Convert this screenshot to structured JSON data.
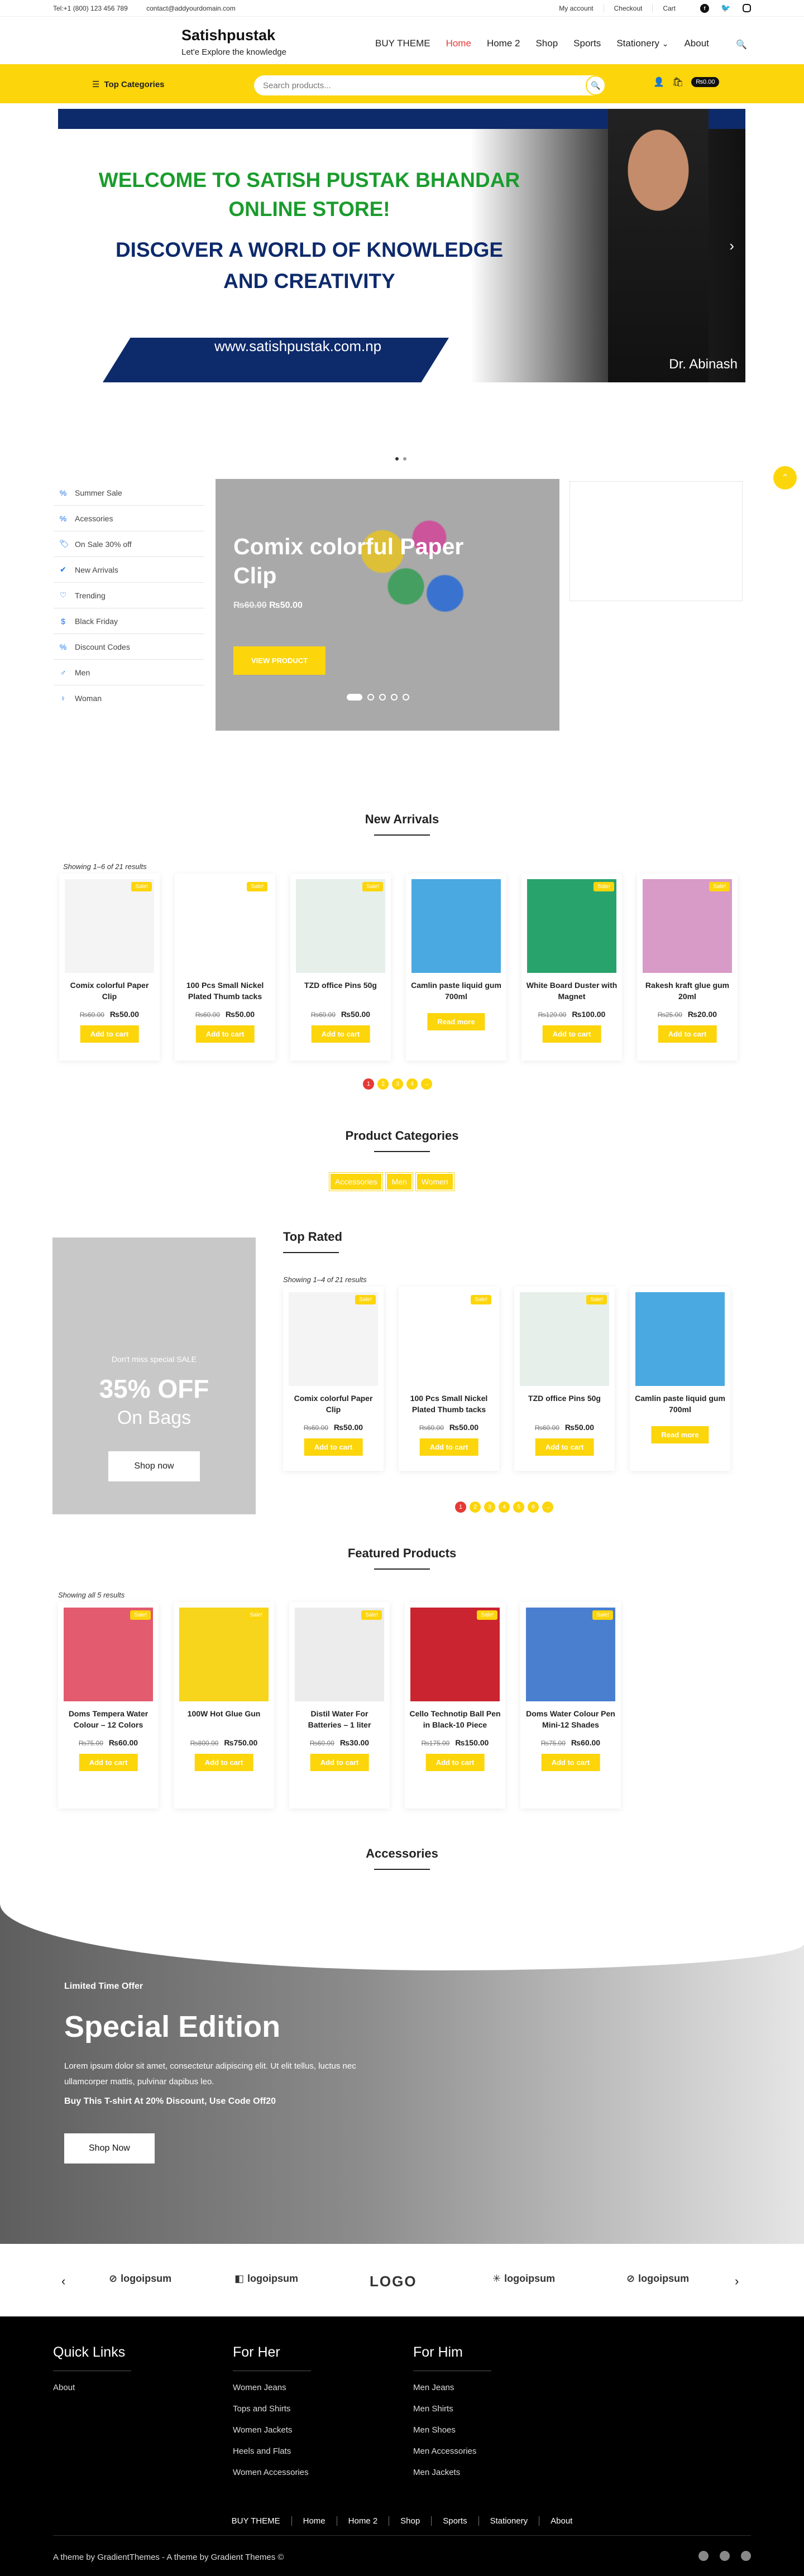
{
  "topbar": {
    "phone": "Tel:+1 (800) 123 456 789",
    "email": "contact@addyourdomain.com",
    "links": [
      "My account",
      "Checkout",
      "Cart"
    ]
  },
  "brand": {
    "title": "Satishpustak",
    "tagline": "Let'e Explore the knowledge"
  },
  "nav": [
    "BUY THEME",
    "Home",
    "Home 2",
    "Shop",
    "Sports",
    "Stationery",
    "About"
  ],
  "bar": {
    "top_categories": "Top Categories",
    "search_placeholder": "Search products...",
    "cart_total": "₨0.00",
    "cart_count": "0"
  },
  "hero": {
    "line1": "WELCOME TO SATISH PUSTAK BHANDAR",
    "line2": "ONLINE STORE!",
    "line3": "DISCOVER A WORLD OF KNOWLEDGE",
    "line4": "AND CREATIVITY",
    "url": "www.satishpustak.com.np",
    "signature": "Dr. Abinash"
  },
  "categories": [
    "Summer Sale",
    "Acessories",
    "On Sale 30% off",
    "New Arrivals",
    "Trending",
    "Black Friday",
    "Discount Codes",
    "Men",
    "Woman"
  ],
  "slider": {
    "title": "Comix colorful Paper Clip",
    "old_price": "₨60.00",
    "price": "₨50.00",
    "button": "VIEW PRODUCT"
  },
  "new_arrivals": {
    "title": "New Arrivals",
    "showing": "Showing 1–6 of 21 results",
    "products": [
      {
        "name": "Comix colorful Paper Clip",
        "old": "₨60.00",
        "price": "₨50.00",
        "btn": "Add to cart",
        "sale": "Sale!"
      },
      {
        "name": "100 Pcs Small Nickel Plated Thumb tacks",
        "old": "₨60.00",
        "price": "₨50.00",
        "btn": "Add to cart",
        "sale": "Sale!"
      },
      {
        "name": "TZD office Pins 50g",
        "old": "₨60.00",
        "price": "₨50.00",
        "btn": "Add to cart",
        "sale": "Sale!"
      },
      {
        "name": "Camlin paste liquid gum 700ml",
        "old": "",
        "price": "",
        "btn": "Read more",
        "sale": ""
      },
      {
        "name": "White Board Duster with Magnet",
        "old": "₨120.00",
        "price": "₨100.00",
        "btn": "Add to cart",
        "sale": "Sale!"
      },
      {
        "name": "Rakesh kraft glue gum 20ml",
        "old": "₨25.00",
        "price": "₨20.00",
        "btn": "Add to cart",
        "sale": "Sale!"
      }
    ],
    "pages": [
      "1",
      "2",
      "3",
      "4",
      "→"
    ]
  },
  "product_categories": {
    "title": "Product Categories",
    "tags": [
      "Accessories",
      "Men",
      "Women"
    ]
  },
  "promo": {
    "small": "Don't miss special SALE",
    "big": "35% OFF",
    "sub": "On Bags",
    "button": "Shop now"
  },
  "top_rated": {
    "title": "Top Rated",
    "showing": "Showing 1–4 of 21 results",
    "products": [
      {
        "name": "Comix colorful Paper Clip",
        "old": "₨60.00",
        "price": "₨50.00",
        "btn": "Add to cart",
        "sale": "Sale!"
      },
      {
        "name": "100 Pcs Small Nickel Plated Thumb tacks",
        "old": "₨60.00",
        "price": "₨50.00",
        "btn": "Add to cart",
        "sale": "Sale!"
      },
      {
        "name": "TZD office Pins 50g",
        "old": "₨60.00",
        "price": "₨50.00",
        "btn": "Add to cart",
        "sale": "Sale!"
      },
      {
        "name": "Camlin paste liquid gum 700ml",
        "old": "",
        "price": "",
        "btn": "Read more",
        "sale": ""
      }
    ],
    "pages": [
      "1",
      "2",
      "3",
      "4",
      "5",
      "6",
      "→"
    ]
  },
  "featured": {
    "title": "Featured Products",
    "showing": "Showing all 5 results",
    "products": [
      {
        "name": "Doms Tempera Water Colour – 12 Colors",
        "old": "₨75.00",
        "price": "₨60.00",
        "btn": "Add to cart",
        "sale": "Sale!"
      },
      {
        "name": "100W Hot Glue Gun",
        "old": "₨800.00",
        "price": "₨750.00",
        "btn": "Add to cart",
        "sale": "Sale!"
      },
      {
        "name": "Distil Water For Batteries – 1 liter",
        "old": "₨60.00",
        "price": "₨30.00",
        "btn": "Add to cart",
        "sale": "Sale!"
      },
      {
        "name": "Cello Technotip Ball Pen in Black-10 Piece",
        "old": "₨175.00",
        "price": "₨150.00",
        "btn": "Add to cart",
        "sale": "Sale!"
      },
      {
        "name": "Doms Water Colour Pen Mini-12 Shades",
        "old": "₨75.00",
        "price": "₨60.00",
        "btn": "Add to cart",
        "sale": "Sale!"
      }
    ]
  },
  "accessories": {
    "title": "Accessories"
  },
  "special": {
    "label": "Limited Time Offer",
    "title": "Special Edition",
    "text": "Lorem ipsum dolor sit amet, consectetur adipiscing elit. Ut elit tellus, luctus nec ullamcorper mattis, pulvinar dapibus leo.",
    "offer": "Buy This T-shirt At 20% Discount, Use Code Off20",
    "button": "Shop Now"
  },
  "logos": [
    "logoipsum",
    "logoipsum",
    "LOGO",
    "logoipsum",
    "logoipsum"
  ],
  "footer": {
    "quick_links": {
      "title": "Quick Links",
      "items": [
        "About"
      ]
    },
    "for_her": {
      "title": "For Her",
      "items": [
        "Women Jeans",
        "Tops and Shirts",
        "Women Jackets",
        "Heels and Flats",
        "Women Accessories"
      ]
    },
    "for_him": {
      "title": "For Him",
      "items": [
        "Men Jeans",
        "Men Shirts",
        "Men Shoes",
        "Men Accessories",
        "Men Jackets"
      ]
    },
    "nav": [
      "BUY THEME",
      "Home",
      "Home 2",
      "Shop",
      "Sports",
      "Stationery",
      "About"
    ],
    "copyright": "A theme by GradientThemes - A theme by Gradient Themes ©"
  },
  "colors": {
    "accent": "#fcd50b",
    "active": "#e53935",
    "footer": "#000000"
  }
}
